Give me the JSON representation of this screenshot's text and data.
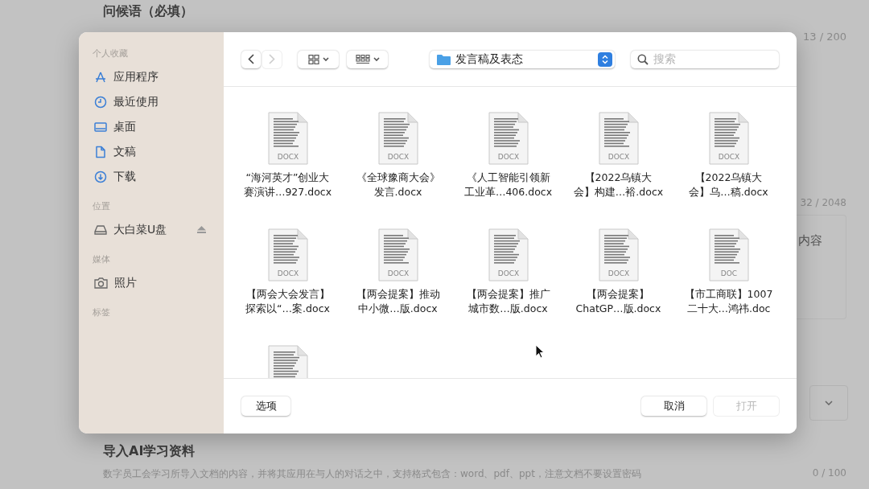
{
  "background": {
    "greeting_title": "问候语（必填）",
    "greeting_count": "13 / 200",
    "content_count": "32 / 2048",
    "content_label": "内容",
    "import_title": "导入AI学习资料",
    "import_hint": "数字员工会学习所导入文档的内容，并将其应用在与人的对话之中，支持格式包含：word、pdf、ppt，注意文档不要设置密码",
    "import_count": "0 / 100"
  },
  "dialog": {
    "sidebar": [
      {
        "title": "个人收藏",
        "items": [
          {
            "label": "应用程序",
            "kind": "apps",
            "selected": false
          },
          {
            "label": "最近使用",
            "kind": "clock",
            "selected": false
          },
          {
            "label": "桌面",
            "kind": "desktop",
            "selected": false
          },
          {
            "label": "文稿",
            "kind": "document",
            "selected": false
          },
          {
            "label": "下载",
            "kind": "download",
            "selected": false
          }
        ]
      },
      {
        "title": "位置",
        "items": [
          {
            "label": "大白菜U盘",
            "kind": "drive",
            "selected": false,
            "eject": true
          }
        ]
      },
      {
        "title": "媒体",
        "items": [
          {
            "label": "照片",
            "kind": "camera",
            "selected": false
          }
        ]
      },
      {
        "title": "标签"
      }
    ],
    "toolbar": {
      "back_disabled": false,
      "forward_disabled": true,
      "folder": "发言稿及表态",
      "search_placeholder": "搜索"
    },
    "files": [
      {
        "name_lines": [
          "“海河英才”创业大",
          "赛演讲…927.docx"
        ],
        "badge": "DOCX",
        "selected": false
      },
      {
        "name_lines": [
          "《全球豫商大会》",
          "发言.docx"
        ],
        "badge": "DOCX",
        "selected": false
      },
      {
        "name_lines": [
          "《人工智能引领新",
          "工业革…406.docx"
        ],
        "badge": "DOCX",
        "selected": false
      },
      {
        "name_lines": [
          "【2022乌镇大",
          "会】构建…裕.docx"
        ],
        "badge": "DOCX",
        "selected": false
      },
      {
        "name_lines": [
          "【2022乌镇大",
          "会】乌…稿.docx"
        ],
        "badge": "DOCX",
        "selected": false
      },
      {
        "name_lines": [
          "【两会大会发言】",
          "探索以“…案.docx"
        ],
        "badge": "DOCX",
        "selected": false
      },
      {
        "name_lines": [
          "【两会提案】推动",
          "中小微…版.docx"
        ],
        "badge": "DOCX",
        "selected": false
      },
      {
        "name_lines": [
          "【两会提案】推广",
          "城市数…版.docx"
        ],
        "badge": "DOCX",
        "selected": false
      },
      {
        "name_lines": [
          "【两会提案】",
          "ChatGP…版.docx"
        ],
        "badge": "DOCX",
        "selected": false
      },
      {
        "name_lines": [
          "【市工商联】1007",
          "二十大…鸿祎.doc"
        ],
        "badge": "DOC",
        "selected": false
      },
      {
        "selected": false
      }
    ],
    "buttons": [
      {
        "label": "选项",
        "kind": "options",
        "disabled": false
      },
      {
        "label": "取消",
        "kind": "cancel",
        "disabled": false
      },
      {
        "label": "打开",
        "kind": "open",
        "disabled": true
      }
    ]
  }
}
